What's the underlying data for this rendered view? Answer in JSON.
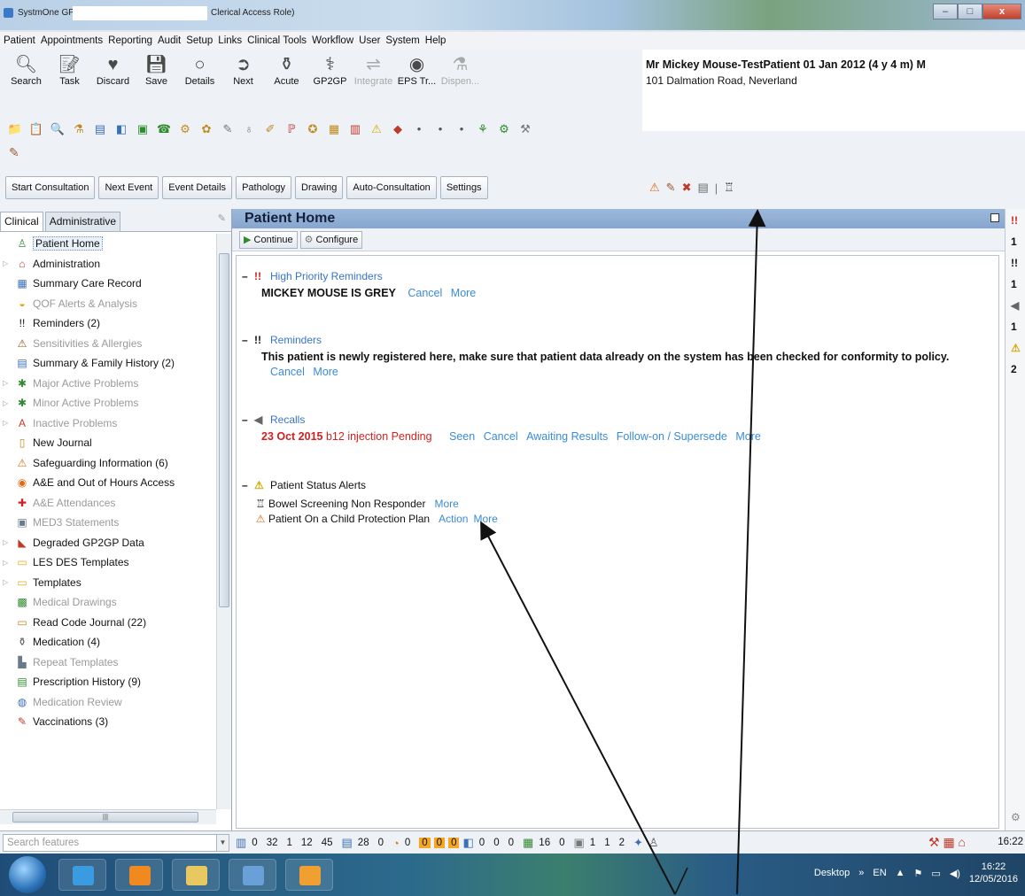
{
  "window": {
    "app_title": "SystmOne GP:",
    "role": "Clerical Access Role)",
    "minimize": "–",
    "maximize": "□",
    "close": "x"
  },
  "menu": [
    "Patient",
    "Appointments",
    "Reporting",
    "Audit",
    "Setup",
    "Links",
    "Clinical Tools",
    "Workflow",
    "User",
    "System",
    "Help"
  ],
  "toolbar": {
    "buttons": [
      {
        "label": "Search",
        "icon": "magnifier-icon",
        "glyph": "🔍︎"
      },
      {
        "label": "Task",
        "icon": "task-icon",
        "glyph": "📝︎"
      },
      {
        "label": "Discard",
        "icon": "discard-icon",
        "glyph": "♥"
      },
      {
        "label": "Save",
        "icon": "save-icon",
        "glyph": "💾︎"
      },
      {
        "label": "Details",
        "icon": "details-icon",
        "glyph": "○"
      },
      {
        "label": "Next",
        "icon": "next-icon",
        "glyph": "➲"
      },
      {
        "label": "Acute",
        "icon": "acute-icon",
        "glyph": "⚱"
      },
      {
        "label": "GP2GP",
        "icon": "gp2gp-icon",
        "glyph": "⚕"
      },
      {
        "label": "Integrate",
        "icon": "integrate-icon",
        "glyph": "⇌"
      },
      {
        "label": "EPS Tr...",
        "icon": "eps-icon",
        "glyph": "◉"
      },
      {
        "label": "Dispen...",
        "icon": "dispense-icon",
        "glyph": "⚗"
      }
    ],
    "small_icons": [
      "📁",
      "📋",
      "🔍",
      "⚗",
      "▤",
      "◧",
      "▣",
      "☎",
      "⚙",
      "✿",
      "✎",
      "♁",
      "✐",
      "ℙ",
      "✪",
      "▦",
      "▥",
      "⚠",
      "◆",
      "•",
      "•",
      "•",
      "⚘",
      "⚙",
      "⚒"
    ],
    "pen_glyph": "✎"
  },
  "tabs": [
    "Start Consultation",
    "Next Event",
    "Event Details",
    "Pathology",
    "Drawing",
    "Auto-Consultation",
    "Settings"
  ],
  "patient": {
    "name": "Mr Mickey Mouse-TestPatient 01 Jan 2012 (4 y  4 m) M",
    "address": "101 Dalmation Road, Neverland",
    "icons": [
      "⚠",
      "✎",
      "✖",
      "▤",
      "|",
      "♖"
    ]
  },
  "left_tabs": {
    "clinical": "Clinical",
    "administrative": "Administrative"
  },
  "nav": [
    {
      "label": "Patient Home",
      "icon": "person-icon",
      "glyph": "♙",
      "color": "#2f8a2f",
      "expand": false,
      "grey": false,
      "selected": true
    },
    {
      "label": "Administration",
      "icon": "house-icon",
      "glyph": "⌂",
      "color": "#c0392b",
      "expand": true,
      "grey": false
    },
    {
      "label": "Summary Care Record",
      "icon": "scr-icon",
      "glyph": "▦",
      "color": "#3b6fb6",
      "expand": false,
      "grey": false
    },
    {
      "label": "QOF Alerts & Analysis",
      "icon": "qof-icon",
      "glyph": "◒",
      "color": "#e0a020",
      "expand": false,
      "grey": true
    },
    {
      "label": "Reminders (2)",
      "icon": "reminder-icon",
      "glyph": "!!",
      "color": "#111111",
      "expand": false,
      "grey": false
    },
    {
      "label": "Sensitivities & Allergies",
      "icon": "allergy-icon",
      "glyph": "⚠",
      "color": "#8a5a20",
      "expand": false,
      "grey": true
    },
    {
      "label": "Summary & Family History (2)",
      "icon": "family-history-icon",
      "glyph": "▤",
      "color": "#3b6fb6",
      "expand": false,
      "grey": false
    },
    {
      "label": "Major Active Problems",
      "icon": "problem-icon",
      "glyph": "✱",
      "color": "#2f8a2f",
      "expand": true,
      "grey": true
    },
    {
      "label": "Minor Active Problems",
      "icon": "problem-icon",
      "glyph": "✱",
      "color": "#2f8a2f",
      "expand": true,
      "grey": true
    },
    {
      "label": "Inactive Problems",
      "icon": "inactive-problem-icon",
      "glyph": "A",
      "color": "#c0392b",
      "expand": true,
      "grey": true
    },
    {
      "label": "New Journal",
      "icon": "journal-icon",
      "glyph": "▯",
      "color": "#c08a20",
      "expand": false,
      "grey": false
    },
    {
      "label": "Safeguarding Information (6)",
      "icon": "safeguarding-icon",
      "glyph": "⚠",
      "color": "#e06a10",
      "expand": false,
      "grey": false
    },
    {
      "label": "A&E and Out of Hours Access",
      "icon": "ae-access-icon",
      "glyph": "◉",
      "color": "#e06a10",
      "expand": false,
      "grey": false
    },
    {
      "label": "A&E Attendances",
      "icon": "ae-cross-icon",
      "glyph": "✚",
      "color": "#d21f1f",
      "expand": false,
      "grey": true
    },
    {
      "label": "MED3 Statements",
      "icon": "med3-icon",
      "glyph": "▣",
      "color": "#6a7a8a",
      "expand": false,
      "grey": true
    },
    {
      "label": "Degraded GP2GP Data",
      "icon": "degraded-icon",
      "glyph": "◣",
      "color": "#c0392b",
      "expand": true,
      "grey": false
    },
    {
      "label": "LES DES Templates",
      "icon": "folder-icon",
      "glyph": "▭",
      "color": "#e0b020",
      "expand": true,
      "grey": false
    },
    {
      "label": "Templates",
      "icon": "folder-icon",
      "glyph": "▭",
      "color": "#e0b020",
      "expand": true,
      "grey": false
    },
    {
      "label": "Medical Drawings",
      "icon": "drawing-icon",
      "glyph": "▩",
      "color": "#2f8a2f",
      "expand": false,
      "grey": true
    },
    {
      "label": "Read Code Journal (22)",
      "icon": "read-code-icon",
      "glyph": "▭",
      "color": "#c08a20",
      "expand": false,
      "grey": false
    },
    {
      "label": "Medication (4)",
      "icon": "medication-icon",
      "glyph": "⚱",
      "color": "#555555",
      "expand": false,
      "grey": false
    },
    {
      "label": "Repeat Templates",
      "icon": "repeat-icon",
      "glyph": "▙",
      "color": "#6a7a8a",
      "expand": false,
      "grey": true
    },
    {
      "label": "Prescription History (9)",
      "icon": "prescription-icon",
      "glyph": "▤",
      "color": "#2f8a2f",
      "expand": false,
      "grey": false
    },
    {
      "label": "Medication Review",
      "icon": "med-review-icon",
      "glyph": "◍",
      "color": "#3b6fb6",
      "expand": false,
      "grey": true
    },
    {
      "label": "Vaccinations (3)",
      "icon": "vaccination-icon",
      "glyph": "✎",
      "color": "#c0392b",
      "expand": false,
      "grey": false
    }
  ],
  "main": {
    "title": "Patient Home",
    "continue": "Continue",
    "configure": "Configure",
    "high_priority": {
      "title": "High Priority Reminders",
      "text": "MICKEY MOUSE IS GREY",
      "links": [
        "Cancel",
        "More"
      ]
    },
    "reminders": {
      "title": "Reminders",
      "text": "This patient is newly registered here, make sure that patient data already on the system has been checked for conformity to policy.",
      "links": [
        "Cancel",
        "More"
      ]
    },
    "recalls": {
      "title": "Recalls",
      "date": "23 Oct 2015",
      "text": "b12 injection Pending",
      "links": [
        "Seen",
        "Cancel",
        "Awaiting Results",
        "Follow-on / Supersede",
        "More"
      ]
    },
    "status_alerts": {
      "title": "Patient Status Alerts",
      "alerts": [
        {
          "text": "Bowel Screening Non Responder",
          "links": [
            "More"
          ]
        },
        {
          "text": "Patient On a Child Protection Plan",
          "links": [
            "Action",
            "More"
          ]
        }
      ]
    }
  },
  "right_strip": [
    "!!",
    "1",
    "!!",
    "1",
    "◀",
    "1",
    "⚠",
    "2"
  ],
  "statusbar": {
    "search_placeholder": "Search features",
    "counts_a": [
      "0",
      "32",
      "1",
      "12",
      "45"
    ],
    "counts_b": [
      "28",
      "0"
    ],
    "counts_c": [
      "0",
      "0",
      "0",
      "0"
    ],
    "counts_d": [
      "0",
      "0",
      "0"
    ],
    "counts_e": [
      "16",
      "0"
    ],
    "counts_f": [
      "1",
      "1",
      "2"
    ],
    "time": "16:22"
  },
  "taskbar": {
    "desktop": "Desktop",
    "chevron": "»",
    "lang": "EN",
    "time": "16:22",
    "date": "12/05/2016"
  },
  "colors": {
    "link": "#3a8bd6",
    "recall_red": "#d21f1f",
    "header_blue": "#86a6cf"
  }
}
